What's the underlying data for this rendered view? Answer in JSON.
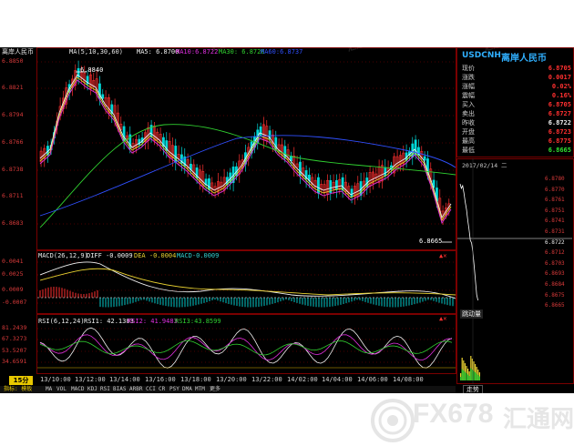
{
  "symbol_name": "离岸人民币",
  "ma_legend": {
    "label": "MA(5,10,30,60)",
    "ma5": "MA5: 6.8700",
    "ma10": "MA10:6.8722",
    "ma30": "MA30: 6.8726",
    "ma60": "MA60:6.8737"
  },
  "price_axis": [
    "6.8850",
    "6.8821",
    "6.8794",
    "6.8766",
    "6.8738",
    "6.8711",
    "6.8683"
  ],
  "high_marker": "6.8840",
  "low_marker": "6.8665",
  "macd_legend": {
    "label": "MACD(26,12,9)",
    "diff": "DIFF -0.0009",
    "dea": "DEA -0.0004",
    "macd": "MACD-0.0009"
  },
  "macd_axis": [
    "0.0041",
    "0.0025",
    "0.0009",
    "-0.0007"
  ],
  "rsi_legend": {
    "label": "RSI(6,12,24)",
    "rsi1": "RSI1: 42.1383",
    "rsi2": "RSI2: 41.9483",
    "rsi3": "RSI3:43.8599"
  },
  "rsi_axis": [
    "81.2439",
    "67.3273",
    "53.5207",
    "34.6591"
  ],
  "period_badge": "15分",
  "time_axis": [
    "13/10:00",
    "13/12:00",
    "13/14:00",
    "13/16:00",
    "13/18:00",
    "13/20:00",
    "13/22:00",
    "14/02:00",
    "14/04:00",
    "14/06:00",
    "14/08:00"
  ],
  "indicator_bar": {
    "prefix": "指标: 模板",
    "items": [
      "MA",
      "VOL",
      "MACD",
      "KDJ",
      "RSI",
      "BIAS",
      "ARBR",
      "CCI",
      "CR",
      "PSY",
      "DMA",
      "MTM",
      "更多"
    ]
  },
  "quote_panel": {
    "code": "USDCNH",
    "name": "离岸人民币",
    "rows": [
      {
        "label": "现价",
        "value": "6.8705",
        "color": "#ff3030"
      },
      {
        "label": "涨跌",
        "value": "0.0017",
        "color": "#ff3030"
      },
      {
        "label": "涨幅",
        "value": "0.02%",
        "color": "#ff3030"
      },
      {
        "label": "震幅",
        "value": "0.16%",
        "color": "#ff3030"
      },
      {
        "label": "买入",
        "value": "6.8705",
        "color": "#ff3030"
      },
      {
        "label": "卖出",
        "value": "6.8727",
        "color": "#ff3030"
      },
      {
        "label": "昨收",
        "value": "6.8722",
        "color": "#f0f0f0"
      },
      {
        "label": "开盘",
        "value": "6.8723",
        "color": "#ff3030"
      },
      {
        "label": "最高",
        "value": "6.8775",
        "color": "#ff3030"
      },
      {
        "label": "最低",
        "value": "6.8665",
        "color": "#30e030"
      }
    ],
    "date": "2017/02/14 二",
    "intraday_axis": [
      "6.8780",
      "6.8770",
      "6.8761",
      "6.8751",
      "6.8741",
      "6.8731",
      "6.8722",
      "6.8712",
      "6.8703",
      "6.8693",
      "6.8684",
      "6.8675",
      "6.8665"
    ],
    "volume_label": "跳动量",
    "bottom_tab": "走势"
  },
  "watermark": {
    "site": "FX678",
    "slogan": "汇通网",
    "stamp": "汇通网"
  }
}
